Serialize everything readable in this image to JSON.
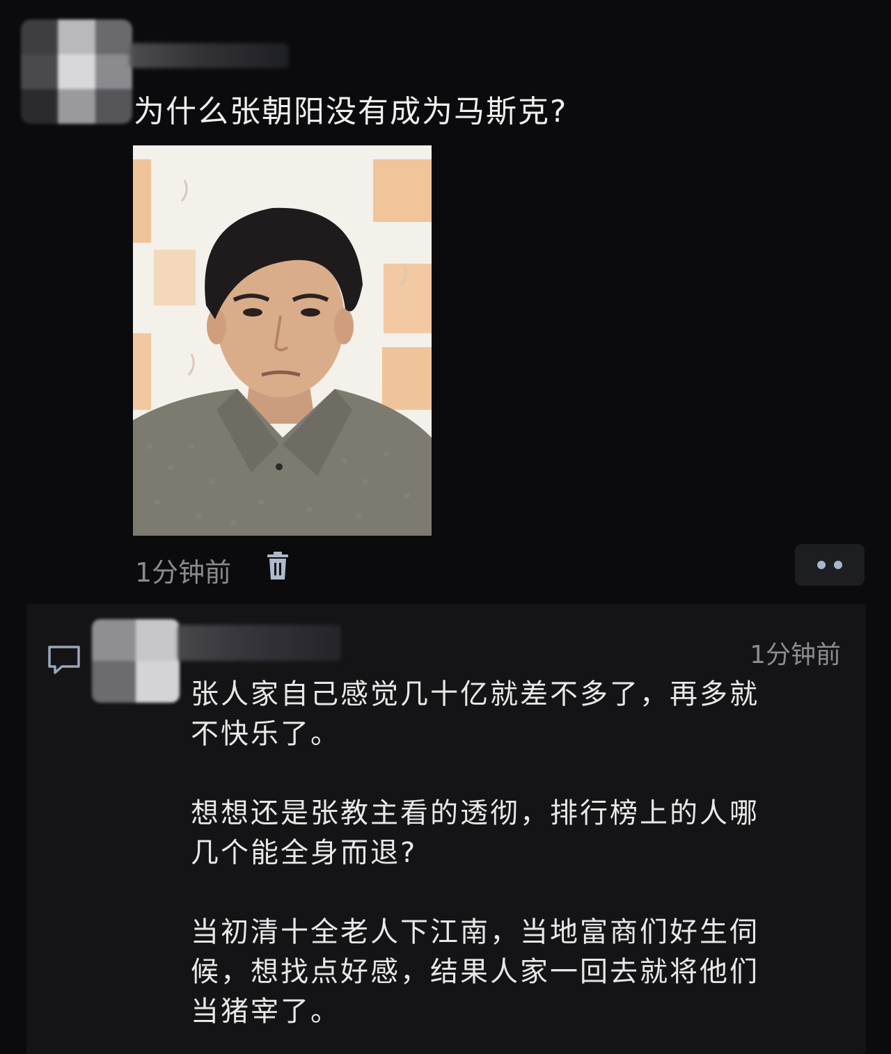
{
  "post": {
    "text": "为什么张朝阳没有成为马斯克?",
    "time": "1分钟前",
    "icons": {
      "delete": "trash-icon",
      "more": "more-dots-icon"
    }
  },
  "comment": {
    "time": "1分钟前",
    "icon": "comment-bubble-icon",
    "paragraphs": [
      "张人家自己感觉几十亿就差不多了，再多就不快乐了。",
      "想想还是张教主看的透彻，排行榜上的人哪几个能全身而退?",
      "当初清十全老人下江南，当地富商们好生伺候，想找点好感，结果人家一回去就将他们当猪宰了。"
    ]
  },
  "colors": {
    "background": "#0b0b0d",
    "panel": "#141416",
    "text": "#e8e8e8",
    "muted": "#8a8a8e",
    "accent": "#a7b6ce"
  }
}
